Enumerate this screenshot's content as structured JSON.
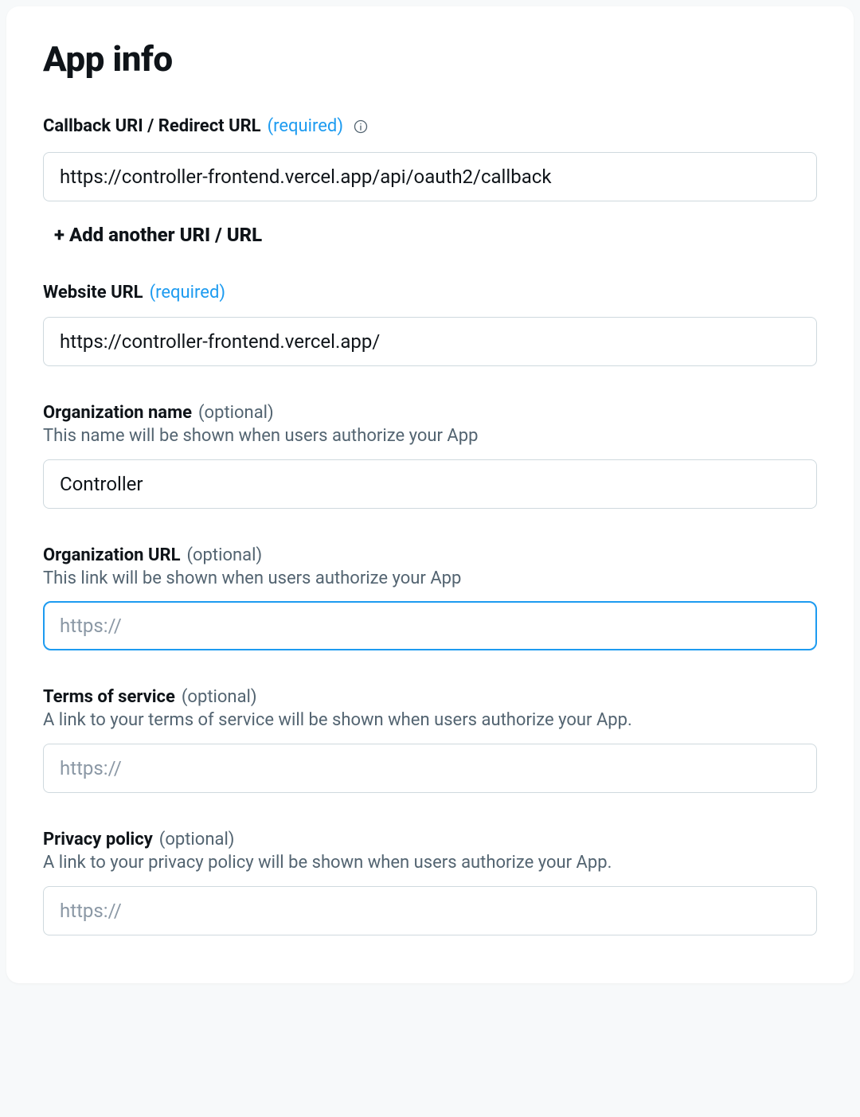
{
  "page": {
    "title": "App info"
  },
  "callback": {
    "label": "Callback URI / Redirect URL",
    "tag": "(required)",
    "value": "https://controller-frontend.vercel.app/api/oauth2/callback",
    "add_another": "Add another URI / URL"
  },
  "website": {
    "label": "Website URL",
    "tag": "(required)",
    "value": "https://controller-frontend.vercel.app/"
  },
  "org_name": {
    "label": "Organization name",
    "tag": "(optional)",
    "helper": "This name will be shown when users authorize your App",
    "value": "Controller"
  },
  "org_url": {
    "label": "Organization URL",
    "tag": "(optional)",
    "helper": "This link will be shown when users authorize your App",
    "value": "",
    "placeholder": "https://"
  },
  "tos": {
    "label": "Terms of service",
    "tag": "(optional)",
    "helper": "A link to your terms of service will be shown when users authorize your App.",
    "value": "",
    "placeholder": "https://"
  },
  "privacy": {
    "label": "Privacy policy",
    "tag": "(optional)",
    "helper": "A link to your privacy policy will be shown when users authorize your App.",
    "value": "",
    "placeholder": "https://"
  }
}
